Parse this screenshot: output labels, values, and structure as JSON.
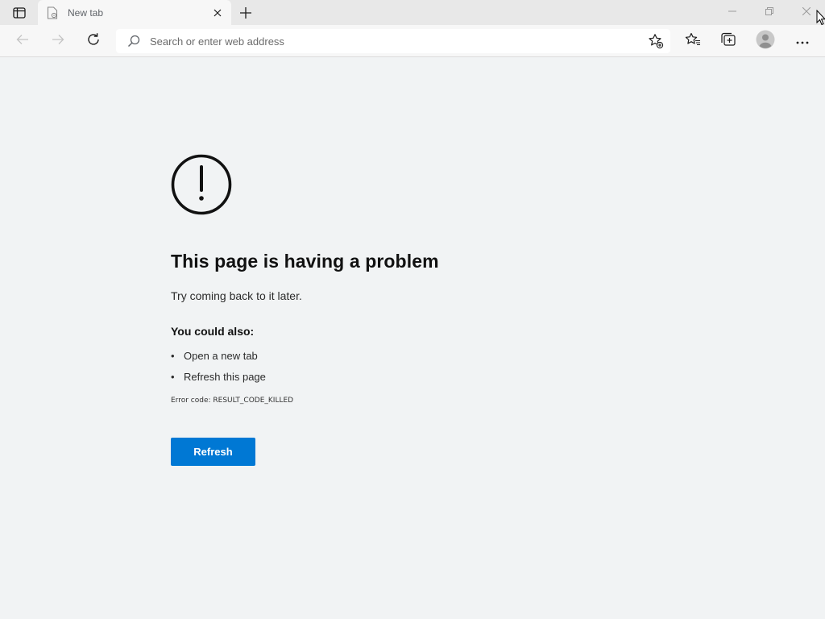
{
  "tab": {
    "title": "New tab"
  },
  "omnibox": {
    "placeholder": "Search or enter web address",
    "value": ""
  },
  "error_page": {
    "heading": "This page is having a problem",
    "subtext": "Try coming back to it later.",
    "also_heading": "You could also:",
    "suggestions": [
      "Open a new tab",
      "Refresh this page"
    ],
    "error_code": "Error code: RESULT_CODE_KILLED",
    "refresh_label": "Refresh"
  },
  "icons": {
    "tab_actions": "tab-actions-icon",
    "favicon": "page-gear-icon",
    "tab_close": "close-icon",
    "new_tab": "plus-icon",
    "minimize": "minimize-icon",
    "restore": "restore-icon",
    "window_close": "close-icon",
    "back": "back-arrow-icon",
    "forward": "forward-arrow-icon",
    "refresh": "refresh-icon",
    "search": "search-icon",
    "add_favorite": "star-add-icon",
    "favorites": "favorites-icon",
    "collections": "collections-icon",
    "profile": "profile-avatar-icon",
    "menu": "more-dots-icon",
    "error": "exclamation-circle-icon"
  },
  "colors": {
    "accent": "#0078d4",
    "page_background": "#f1f3f4"
  }
}
